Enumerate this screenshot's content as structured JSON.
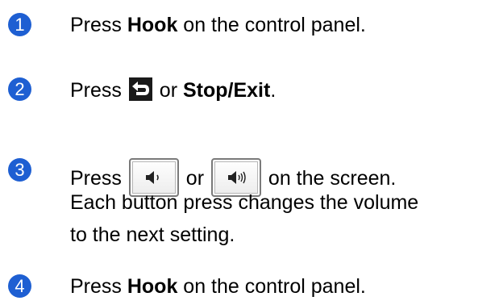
{
  "badge_color": "#1e5fd2",
  "steps": [
    {
      "number": "1",
      "parts": [
        "Press ",
        "Hook",
        " on the control panel."
      ]
    },
    {
      "number": "2",
      "icon": "back-arrow-icon",
      "parts": [
        "Press ",
        " or ",
        "Stop/Exit",
        "."
      ]
    },
    {
      "number": "3",
      "icons": [
        "volume-down-icon",
        "volume-up-icon"
      ],
      "parts": [
        "Press ",
        " or ",
        " on the screen."
      ],
      "line2": "Each button press changes the volume",
      "line3": "to the next setting."
    },
    {
      "number": "4",
      "parts": [
        "Press ",
        "Hook",
        " on the control panel."
      ]
    }
  ]
}
